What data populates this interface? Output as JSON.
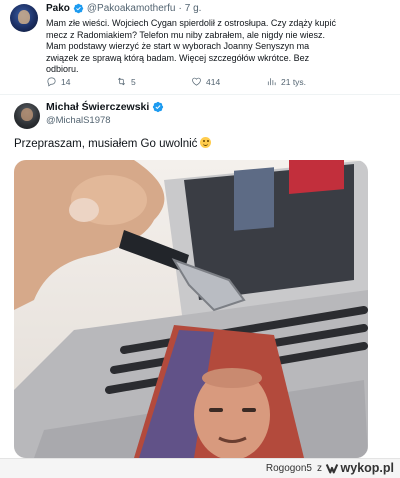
{
  "quoted_tweet": {
    "author_name": "Pako",
    "author_handle": "@Pakoakamotherfu",
    "separator": "·",
    "time": "7 g.",
    "text": "Mam złe wieści. Wojciech Cygan spierdolił z ostrosłupa. Czy zdąży kupić mecz z Radomiakiem? Telefon mu niby zabrałem, ale nigdy nie wiesz. Mam podstawy wierzyć że start w wyborach Joanny Senyszyn ma związek ze sprawą którą badam. Więcej szczegółów wkrótce. Bez odbioru.",
    "replies": "14",
    "retweets": "5",
    "likes": "414",
    "views": "21 tys.",
    "icons": [
      "reply-icon",
      "retweet-icon",
      "like-icon",
      "views-icon"
    ]
  },
  "main_tweet": {
    "author_name": "Michał Świerczewski",
    "author_handle": "@MichalS1978",
    "text": "Przepraszam, musiałem Go uwolnić",
    "emoji": "winking-face-icon"
  },
  "colors": {
    "verified": "#1d9bf0",
    "text_secondary": "#536471",
    "wykop_blue": "#347fd3"
  },
  "footer": {
    "username": "Rogogon5",
    "conjunction": "z",
    "logo_text": "wykop.pl"
  }
}
